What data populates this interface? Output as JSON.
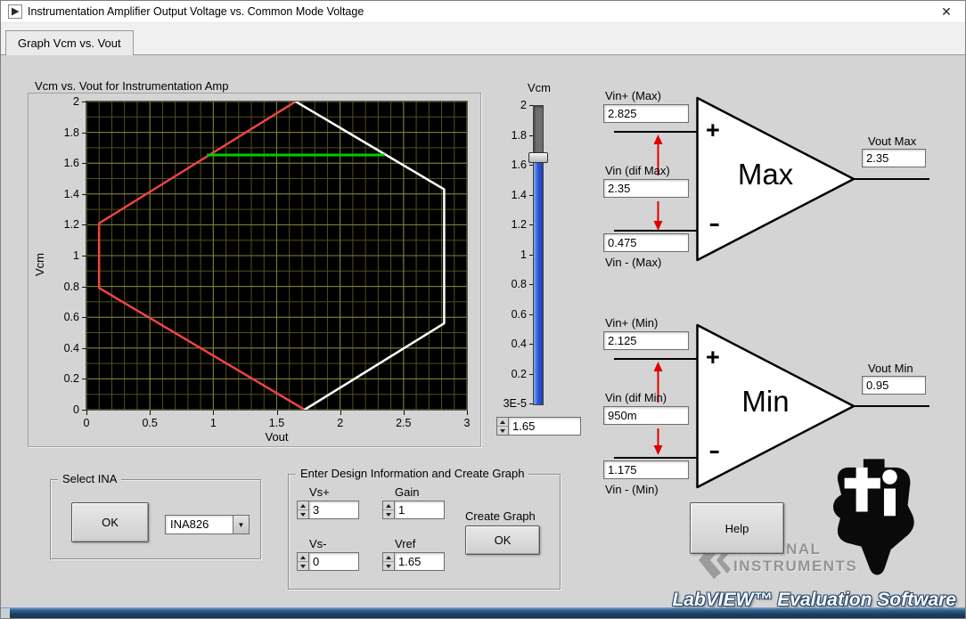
{
  "window": {
    "title": "Instrumentation Amplifier Output Voltage vs. Common Mode Voltage",
    "close_glyph": "✕"
  },
  "tabs": {
    "graph_tab": "Graph Vcm vs. Vout"
  },
  "chart_data": {
    "type": "line",
    "title": "Vcm vs. Vout for Instrumentation Amp",
    "xlabel": "Vout",
    "ylabel": "Vcm",
    "xlim": [
      0,
      3
    ],
    "ylim": [
      0,
      2
    ],
    "x_ticks": [
      "0",
      "0.5",
      "1",
      "1.5",
      "2",
      "2.5",
      "3"
    ],
    "y_ticks": [
      "2",
      "1.8",
      "1.6",
      "1.4",
      "1.2",
      "1",
      "0.8",
      "0.6",
      "0.4",
      "0.2",
      "0"
    ],
    "x_major_step": 0.5,
    "y_major_step": 0.2,
    "minor_step": 0.1,
    "grid": true,
    "plot_bg": "#000000",
    "grid_minor_color": "#50501c",
    "grid_major_color": "#82823a",
    "series": [
      {
        "name": "left-boundary-red",
        "color": "#ee4444",
        "width": 2.5,
        "points": [
          [
            1.65,
            2
          ],
          [
            0.1,
            1.21
          ],
          [
            0.1,
            0.79
          ],
          [
            1.72,
            0
          ]
        ]
      },
      {
        "name": "right-boundary-white",
        "color": "#ffffff",
        "width": 2.5,
        "points": [
          [
            1.65,
            2
          ],
          [
            2.82,
            1.43
          ],
          [
            2.82,
            0.56
          ],
          [
            1.72,
            0
          ]
        ]
      },
      {
        "name": "vcm-operating-line-green",
        "color": "#00cc00",
        "width": 3,
        "points": [
          [
            0.95,
            1.653
          ],
          [
            2.35,
            1.653
          ]
        ]
      }
    ]
  },
  "slider": {
    "label": "Vcm",
    "ticks": [
      "2",
      "1.8",
      "1.6",
      "1.4",
      "1.2",
      "1",
      "0.8",
      "0.6",
      "0.4",
      "0.2"
    ],
    "min_label": "3E-5",
    "value": "1.65",
    "value_norm": 0.825,
    "fill_color": "#2f5bd6"
  },
  "amp_max": {
    "title": "Max",
    "plus_glyph": "+",
    "minus_glyph": "-",
    "vin_plus_label": "Vin+ (Max)",
    "vin_plus_value": "2.825",
    "vin_dif_label": "Vin (dif Max)",
    "vin_dif_value": "2.35",
    "vin_minus_label": "Vin - (Max)",
    "vin_minus_value": "0.475",
    "vout_label": "Vout Max",
    "vout_value": "2.35"
  },
  "amp_min": {
    "title": "Min",
    "plus_glyph": "+",
    "minus_glyph": "-",
    "vin_plus_label": "Vin+ (Min)",
    "vin_plus_value": "2.125",
    "vin_dif_label": "Vin (dif Min)",
    "vin_dif_value": "950m",
    "vin_minus_label": "Vin - (Min)",
    "vin_minus_value": "1.175",
    "vout_label": "Vout Min",
    "vout_value": "0.95"
  },
  "select_ina": {
    "group_label": "Select INA",
    "ok_label": "OK",
    "dropdown_value": "INA826",
    "dropdown_arrow": "▼"
  },
  "design": {
    "group_label": "Enter Design Information and Create Graph",
    "vs_plus_label": "Vs+",
    "vs_plus_value": "3",
    "gain_label": "Gain",
    "gain_value": "1",
    "vs_minus_label": "Vs-",
    "vs_minus_value": "0",
    "vref_label": "Vref",
    "vref_value": "1.65",
    "create_graph_label": "Create Graph",
    "create_graph_ok": "OK"
  },
  "help": {
    "label": "Help"
  },
  "branding": {
    "ni_line1": "NATIONAL",
    "ni_line2": "INSTRUMENTS",
    "eval_text": "LabVIEW™ Evaluation Software"
  }
}
